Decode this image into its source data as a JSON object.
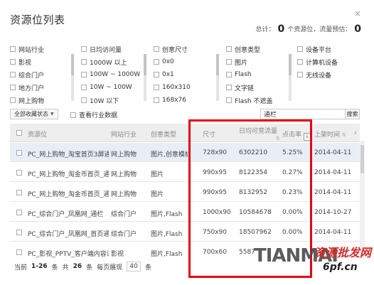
{
  "header": {
    "title": "资源位列表",
    "close_label": "×",
    "summary": {
      "prefix": "总计：",
      "resource_count": "0",
      "resource_unit": "个资源位，流量预估：",
      "traffic_estimate": "0"
    }
  },
  "filters": {
    "columns": [
      {
        "items": [
          "网站行业",
          "影视",
          "综合门户",
          "地方门户",
          "网上购物"
        ]
      },
      {
        "items": [
          "日均访问量",
          "1000W 以上",
          "100W ~ 1000W",
          "10W ~ 100W",
          "10W 以下"
        ]
      },
      {
        "items": [
          "创意尺寸",
          "0x0",
          "0x1",
          "160x310",
          "168x76"
        ]
      },
      {
        "items": [
          "创意类型",
          "图片",
          "Flash",
          "文字链",
          "Flash 不遮盖"
        ]
      },
      {
        "items": [
          "设备平台",
          "计算机设备",
          "无线设备"
        ]
      }
    ]
  },
  "toolbar": {
    "collect_status_label": "全部收藏状态",
    "dropdown_arrow": "▼",
    "industry_data_label": "查看行业数据",
    "search_value": "通栏",
    "search_button_label": "搜索"
  },
  "table": {
    "headers": {
      "resource": "资源位",
      "industry": "网站行业",
      "creative_type": "创意类型",
      "size": "尺寸",
      "daily_traffic": "日均可竞流量",
      "ctr": "点击率",
      "online_time": "上架时间",
      "sort_icon": "⇅",
      "sort_active_icon": "↓",
      "scroll_right": "›"
    },
    "rows": [
      {
        "name": "PC_网上购物_淘宝首页3屏通栏",
        "industry": "网上购物",
        "type": "图片,创意模板",
        "size": "728x90",
        "traffic": "6302210",
        "ctr": "5.25%",
        "date": "2014-04-11"
      },
      {
        "name": "PC_网上购物_淘金币首页_通栏",
        "industry": "网上购物",
        "type": "图片",
        "size": "990x95",
        "traffic": "8122354",
        "ctr": "0.27%",
        "date": "2014-04-11"
      },
      {
        "name": "PC_网上购物_淘金币首页_通栏",
        "industry": "网上购物",
        "type": "图片",
        "size": "990x95",
        "traffic": "8132952",
        "ctr": "0.23%",
        "date": "2014-04-11"
      },
      {
        "name": "PC_综合门户_凤凰网_通栏",
        "industry": "综合门户",
        "type": "图片,Flash",
        "size": "1000x90",
        "traffic": "10584678",
        "ctr": "0.00%",
        "date": "2014-10-27"
      },
      {
        "name": "PC_综合门户_凤凰网_首页通栏",
        "industry": "综合门户",
        "type": "图片,Flash",
        "size": "750x90",
        "traffic": "18507962",
        "ctr": "0.00%",
        "date": "2014-04-11"
      },
      {
        "name": "PC_影视_PPTV_客户端内容详...",
        "industry": "影视",
        "type": "图片,Flash",
        "size": "700x60",
        "traffic": "5587",
        "ctr": "",
        "date": ""
      }
    ]
  },
  "footer": {
    "current_label": "当前",
    "range": "1-26",
    "items_unit": "条",
    "total_label": "共",
    "total": "26",
    "per_page_label": "每页展现",
    "per_page": "40"
  },
  "watermark": {
    "brand": "TIANMAI",
    "cn_text": "资源批发网",
    "site": "6pf.cn"
  },
  "colors": {
    "highlight_border": "#e60012",
    "selected_row": "#e9eef6",
    "header_bg": "#eeeeee"
  }
}
